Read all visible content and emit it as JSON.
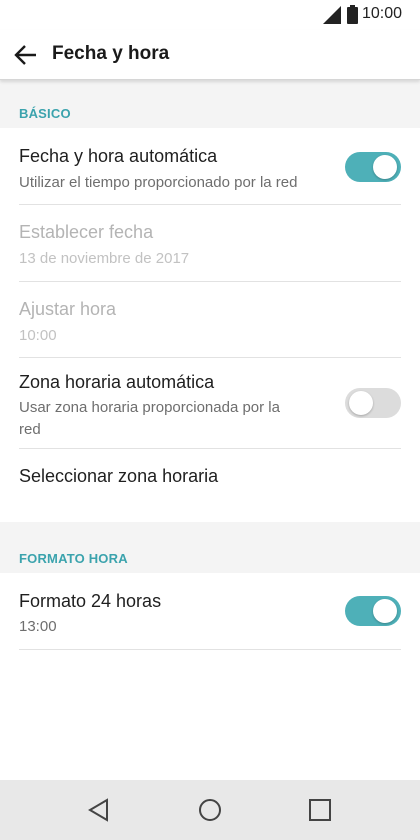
{
  "status_bar": {
    "time": "10:00",
    "icons": [
      "signal-icon",
      "battery-icon"
    ]
  },
  "app_bar": {
    "title": "Fecha y hora",
    "back_icon": "arrow-back-icon"
  },
  "colors": {
    "accent": "#3ba3ad",
    "switch_on": "#4eb0b8",
    "switch_off": "#dcdcdc",
    "background": "#f4f4f4"
  },
  "sections": [
    {
      "header": "BÁSICO",
      "items": [
        {
          "title": "Fecha y hora automática",
          "subtitle": "Utilizar el tiempo proporcionado por la red",
          "switch": "on",
          "enabled": true
        },
        {
          "title": "Establecer fecha",
          "subtitle": "13 de noviembre de 2017",
          "enabled": false
        },
        {
          "title": "Ajustar hora",
          "subtitle": "10:00",
          "enabled": false
        },
        {
          "title": "Zona horaria automática",
          "subtitle_line1": "Usar zona horaria proporcionada por la",
          "subtitle_line2": "red",
          "switch": "off",
          "enabled": true
        },
        {
          "title": "Seleccionar zona horaria",
          "enabled": true
        }
      ]
    },
    {
      "header": "FORMATO HORA",
      "items": [
        {
          "title": "Formato 24 horas",
          "subtitle": "13:00",
          "switch": "on",
          "enabled": true
        }
      ]
    }
  ],
  "nav_bar": {
    "icons": [
      "back-triangle-icon",
      "home-circle-icon",
      "recents-square-icon"
    ]
  }
}
